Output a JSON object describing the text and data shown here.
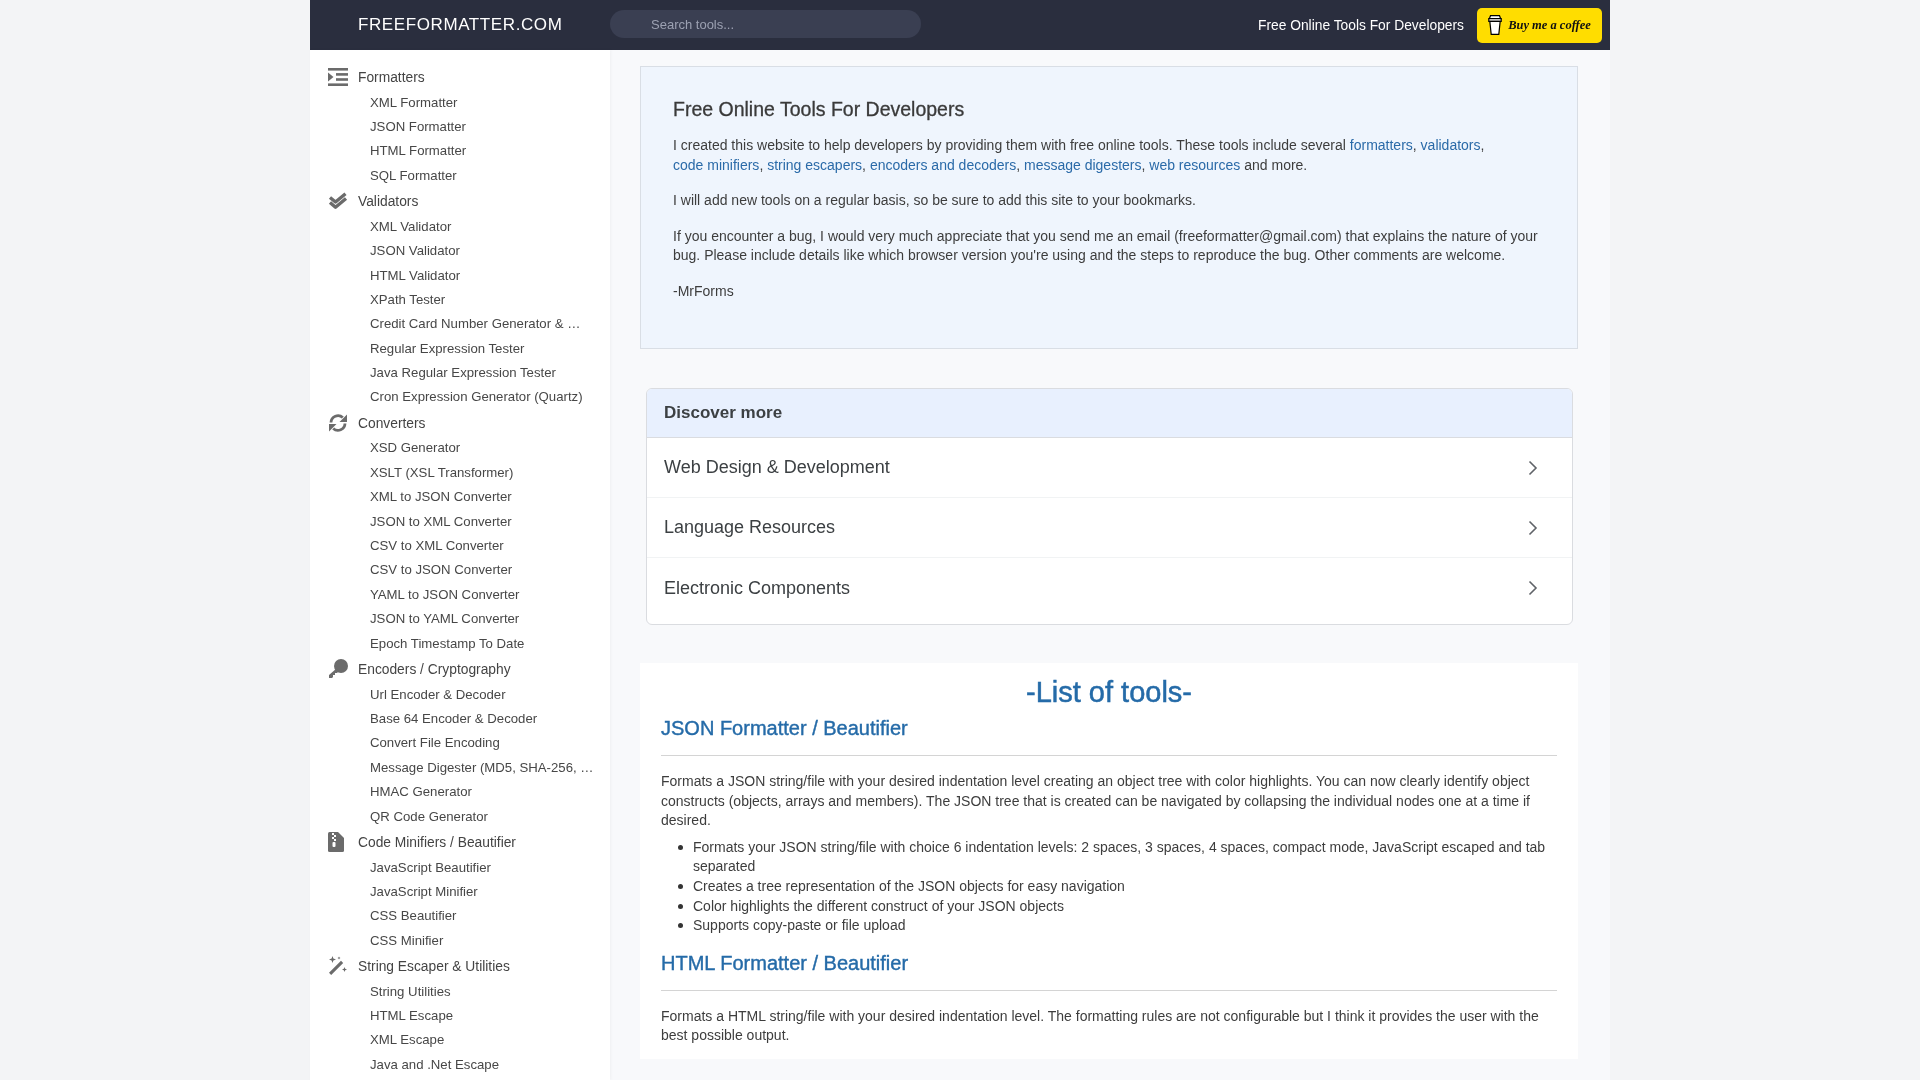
{
  "header": {
    "logo": "FREEFORMATTER.COM",
    "search": {
      "placeholder": "Search tools..."
    },
    "tagline": "Free Online Tools For Developers",
    "coffee_button": "Buy me a coffee"
  },
  "sidebar": {
    "categories": [
      {
        "label": "Formatters",
        "children": [
          {
            "label": "XML Formatter"
          },
          {
            "label": "JSON Formatter"
          },
          {
            "label": "HTML Formatter"
          },
          {
            "label": "SQL Formatter"
          }
        ]
      },
      {
        "label": "Validators",
        "children": [
          {
            "label": "XML Validator"
          },
          {
            "label": "JSON Validator"
          },
          {
            "label": "HTML Validator"
          },
          {
            "label": "XPath Tester"
          },
          {
            "label": "Credit Card Number Generator & …"
          },
          {
            "label": "Regular Expression Tester"
          },
          {
            "label": "Java Regular Expression Tester"
          },
          {
            "label": "Cron Expression Generator (Quartz)"
          }
        ]
      },
      {
        "label": "Converters",
        "children": [
          {
            "label": "XSD Generator"
          },
          {
            "label": "XSLT (XSL Transformer)"
          },
          {
            "label": "XML to JSON Converter"
          },
          {
            "label": "JSON to XML Converter"
          },
          {
            "label": "CSV to XML Converter"
          },
          {
            "label": "CSV to JSON Converter"
          },
          {
            "label": "YAML to JSON Converter"
          },
          {
            "label": "JSON to YAML Converter"
          },
          {
            "label": "Epoch Timestamp To Date"
          }
        ]
      },
      {
        "label": "Encoders / Cryptography",
        "children": [
          {
            "label": "Url Encoder & Decoder"
          },
          {
            "label": "Base 64 Encoder & Decoder"
          },
          {
            "label": "Convert File Encoding"
          },
          {
            "label": "Message Digester (MD5, SHA-256, …"
          },
          {
            "label": "HMAC Generator"
          },
          {
            "label": "QR Code Generator"
          }
        ]
      },
      {
        "label": "Code Minifiers / Beautifier",
        "children": [
          {
            "label": "JavaScript Beautifier"
          },
          {
            "label": "JavaScript Minifier"
          },
          {
            "label": "CSS Beautifier"
          },
          {
            "label": "CSS Minifier"
          }
        ]
      },
      {
        "label": "String Escaper & Utilities",
        "children": [
          {
            "label": "String Utilities"
          },
          {
            "label": "HTML Escape"
          },
          {
            "label": "XML Escape"
          },
          {
            "label": "Java and .Net Escape"
          }
        ]
      }
    ]
  },
  "intro": {
    "title": "Free Online Tools For Developers",
    "paragraphs": [
      {
        "parts": [
          {
            "kind": "text",
            "text": "I created this website to help developers by providing them with free online tools. These tools include several "
          },
          {
            "kind": "link",
            "text": "formatters"
          },
          {
            "kind": "text",
            "text": ", "
          },
          {
            "kind": "link",
            "text": "validators"
          },
          {
            "kind": "text",
            "text": ", "
          },
          {
            "kind": "link",
            "text": "code minifiers"
          },
          {
            "kind": "text",
            "text": ", "
          },
          {
            "kind": "link",
            "text": "string escapers"
          },
          {
            "kind": "text",
            "text": ", "
          },
          {
            "kind": "link",
            "text": "encoders and decoders"
          },
          {
            "kind": "text",
            "text": ", "
          },
          {
            "kind": "link",
            "text": "message digesters"
          },
          {
            "kind": "text",
            "text": ", "
          },
          {
            "kind": "link",
            "text": "web resources"
          },
          {
            "kind": "text",
            "text": " and more."
          }
        ]
      },
      {
        "parts": [
          {
            "kind": "text",
            "text": "I will add new tools on a regular basis, so be sure to add this site to your bookmarks."
          }
        ]
      },
      {
        "parts": [
          {
            "kind": "text",
            "text": "If you encounter a bug, I would very much appreciate that you send me an email (freeformatter@gmail.com) that explains the nature of your bug. Please include details like which browser version you're using and the steps to reproduce the bug. Other comments are welcome."
          }
        ]
      },
      {
        "parts": [
          {
            "kind": "text",
            "text": "-MrForms"
          }
        ]
      }
    ]
  },
  "discover": {
    "title": "Discover more",
    "links": [
      "Web Design & Development",
      "Language Resources",
      "Electronic Components"
    ]
  },
  "tools": {
    "title": "-List of tools-",
    "sections": [
      {
        "heading": "JSON Formatter / Beautifier",
        "description": "Formats a JSON string/file with your desired indentation level creating an object tree with color highlights. You can now clearly identify object constructs (objects, arrays and members). The JSON tree that is created can be navigated by collapsing the individual nodes one at a time if desired.",
        "bullets": [
          "Formats your JSON string/file with choice 6 indentation levels: 2 spaces, 3 spaces, 4 spaces, compact mode, JavaScript escaped and tab separated",
          "Creates a tree representation of the JSON objects for easy navigation",
          "Color highlights the different construct of your JSON objects",
          "Supports copy-paste or file upload"
        ]
      },
      {
        "heading": "HTML Formatter / Beautifier",
        "description": "Formats a HTML string/file with your desired indentation level. The formatting rules are not configurable but I think it provides the user with the best possible output."
      }
    ]
  }
}
